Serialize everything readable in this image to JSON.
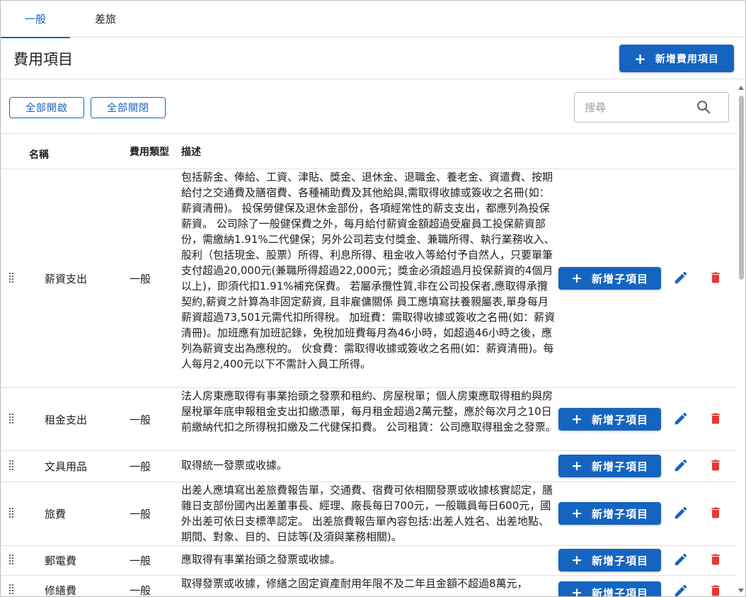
{
  "tabs": [
    {
      "label": "一般",
      "active": true
    },
    {
      "label": "差旅",
      "active": false
    }
  ],
  "page": {
    "title": "費用項目",
    "add_button_label": "新增費用項目"
  },
  "toolbar": {
    "expand_all": "全部開啟",
    "collapse_all": "全部關閉"
  },
  "search": {
    "placeholder": "搜尋",
    "value": ""
  },
  "table": {
    "headers": {
      "name": "名稱",
      "type": "費用類型",
      "description": "描述"
    },
    "add_sub_label": "新增子項目",
    "rows": [
      {
        "name": "薪資支出",
        "type": "一般",
        "description": "包括薪金、俸給、工資、津貼、獎金、退休金、退職金、養老金、資遣費、按期給付之交通費及膳宿費、各種補助費及其他給與,需取得收據或簽收之名冊(如：薪資清冊)。 投保勞健保及退休金部份，各項經常性的薪支支出，都應列為投保薪資。 公司除了一般健保費之外，每月給付薪資金額超過受雇員工投保薪資部份，需繳納1.91%二代健保；另外公司若支付獎金、兼職所得、執行業務收入、股利（包括現金、股票）所得、利息所得、租金收入等給付予自然人，只要單筆支付超過20,000元(兼職所得超過22,000元；獎金必須超過月投保薪資的4個月以上)，即須代扣1.91%補充保費。 若屬承攬性質,非在公司投保者,應取得承攬契約,薪資之計算為非固定薪資, 且非雇傭關係 員工應填寫扶養親屬表,單身每月薪資超過73,501元需代扣所得稅。 加班費：需取得收據或簽收之名冊(如：薪資清冊)。加班應有加班記錄，免稅加班費每月為46小時，如超過46小時之後，應列為薪資支出為應稅的。 伙食費：需取得收據或簽收之名冊(如：薪資清冊)。每人每月2,400元以下不需計入員工所得。"
      },
      {
        "name": "租金支出",
        "type": "一般",
        "description": "法人房東應取得有事業抬頭之發票和租約、房屋稅單；個人房東應取得租約與房屋稅單年底申報租金支出扣繳憑單，每月租金超過2萬元整，應於每次月之10日前繳納代扣之所得稅扣繳及二代健保扣費。 公司租賃：公司應取得租金之發票。"
      },
      {
        "name": "文具用品",
        "type": "一般",
        "description": "取得統一發票或收據。"
      },
      {
        "name": "旅費",
        "type": "一般",
        "description": "出差人應填寫出差旅費報告單，交通費、宿費可依相關發票或收據核實認定，膳雜日支部份國內出差董事長、經理、廠長每日700元，一般職員每日600元，國外出差可依日支標準認定。 出差旅費報告單內容包括:出差人姓名、出差地點、期間、對象、目的、日誌等(及須與業務相關)。"
      },
      {
        "name": "郵電費",
        "type": "一般",
        "description": "應取得有事業抬頭之發票或收據。"
      },
      {
        "name": "修繕費",
        "type": "一般",
        "description": "取得發票或收據，修繕之固定資產耐用年限不及二年且金額不超過8萬元，"
      }
    ]
  },
  "colors": {
    "primary": "#1565c0",
    "delete": "#e53935",
    "divider": "#e0e0e0"
  }
}
